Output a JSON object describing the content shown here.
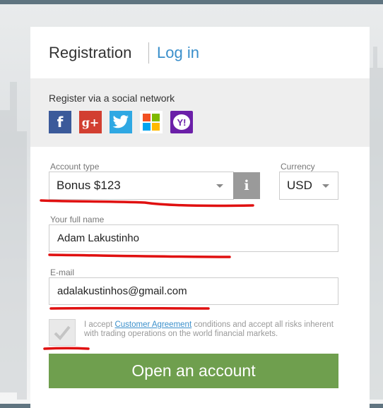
{
  "tabs": {
    "registration": "Registration",
    "login": "Log in"
  },
  "social": {
    "label": "Register via a social network",
    "networks": [
      "facebook",
      "google-plus",
      "twitter",
      "microsoft",
      "yahoo"
    ],
    "glyphs": {
      "facebook": "f",
      "google_plus": "g+",
      "yahoo": "Y!"
    }
  },
  "form": {
    "account_type_label": "Account type",
    "account_type_value": "Bonus $123",
    "info_glyph": "i",
    "currency_label": "Currency",
    "currency_value": "USD",
    "full_name_label": "Your full name",
    "full_name_value": "Adam Lakustinho",
    "email_label": "E-mail",
    "email_value": "adalakustinhos@gmail.com",
    "agree_prefix": "I accept",
    "agree_link": "Customer Agreement",
    "agree_suffix": "conditions and accept all risks inherent with trading operations on the world financial markets.",
    "agree_checked": true,
    "submit_label": "Open an account"
  },
  "colors": {
    "accent_link": "#3a8fcb",
    "submit_green": "#6f9f4e",
    "annotation_red": "#e01010",
    "facebook": "#3b5a9a",
    "google_plus": "#d23f31",
    "twitter": "#2fa8e3",
    "yahoo": "#6b1fa8"
  }
}
